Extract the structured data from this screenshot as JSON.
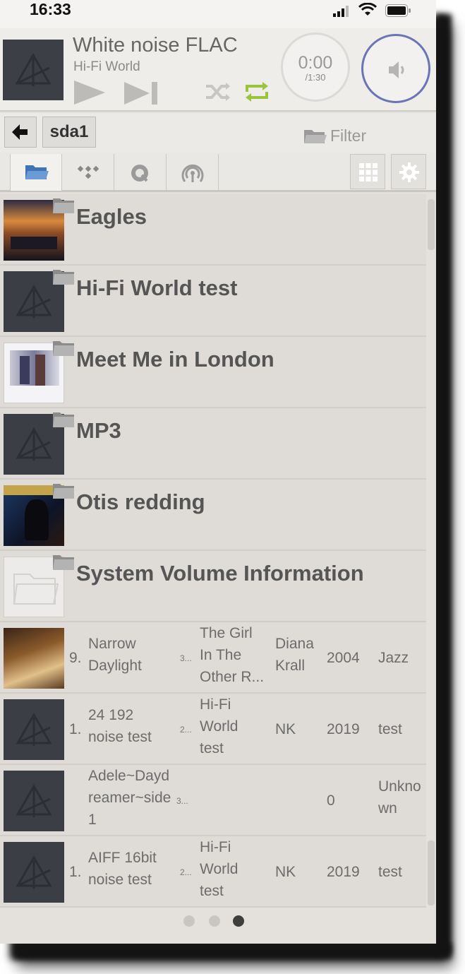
{
  "status_bar": {
    "time": "16:33"
  },
  "player": {
    "title": "White noise FLAC",
    "subtitle": "Hi-Fi World",
    "elapsed": "0:00",
    "duration": "/1:30",
    "icons": [
      "play-icon",
      "skip-next-icon",
      "shuffle-icon",
      "repeat-icon",
      "volume-icon"
    ],
    "repeat_color": "#9bc43a",
    "volume_ring_color": "#6a74b6"
  },
  "nav": {
    "back_icon": "arrow-left-icon",
    "path": "sda1",
    "filter_label": "Filter"
  },
  "source_tabs": [
    "folder-icon",
    "tidal-icon",
    "qobuz-icon",
    "radio-icon"
  ],
  "folders": [
    {
      "name": "Eagles",
      "art": "album-art"
    },
    {
      "name": "Hi-Fi World test",
      "art": "placeholder"
    },
    {
      "name": "Meet Me in London",
      "art": "album-art"
    },
    {
      "name": "MP3",
      "art": "placeholder"
    },
    {
      "name": "Otis redding",
      "art": "album-art"
    },
    {
      "name": "System Volume Information",
      "art": "empty-folder"
    }
  ],
  "tracks": [
    {
      "num": "9.",
      "title_l1": "Narrow",
      "title_l2": "Daylight",
      "disc": "3...",
      "album_l1": "The Girl",
      "album_l2": "In The",
      "album_l3": "Other R...",
      "artist_l1": "Diana",
      "artist_l2": "Krall",
      "year": "2004",
      "genre_l1": "Jazz",
      "genre_l2": ""
    },
    {
      "num": "1.",
      "title_l1": "24 192",
      "title_l2": "noise test",
      "disc": "2...",
      "album_l1": "Hi-Fi",
      "album_l2": "World",
      "album_l3": "test",
      "artist_l1": "NK",
      "artist_l2": "",
      "year": "2019",
      "genre_l1": "test",
      "genre_l2": ""
    },
    {
      "num": "",
      "title_l1": "Adele~Dayd",
      "title_l2": "reamer~side",
      "title_l3": "1",
      "disc": "3...",
      "album_l1": "",
      "album_l2": "",
      "album_l3": "",
      "artist_l1": "",
      "artist_l2": "",
      "year": "0",
      "genre_l1": "Unkno",
      "genre_l2": "wn"
    },
    {
      "num": "1.",
      "title_l1": "AIFF 16bit",
      "title_l2": "noise test",
      "disc": "2...",
      "album_l1": "Hi-Fi",
      "album_l2": "World",
      "album_l3": "test",
      "artist_l1": "NK",
      "artist_l2": "",
      "year": "2019",
      "genre_l1": "test",
      "genre_l2": ""
    }
  ],
  "pager": {
    "pages": 3,
    "current": 3
  }
}
